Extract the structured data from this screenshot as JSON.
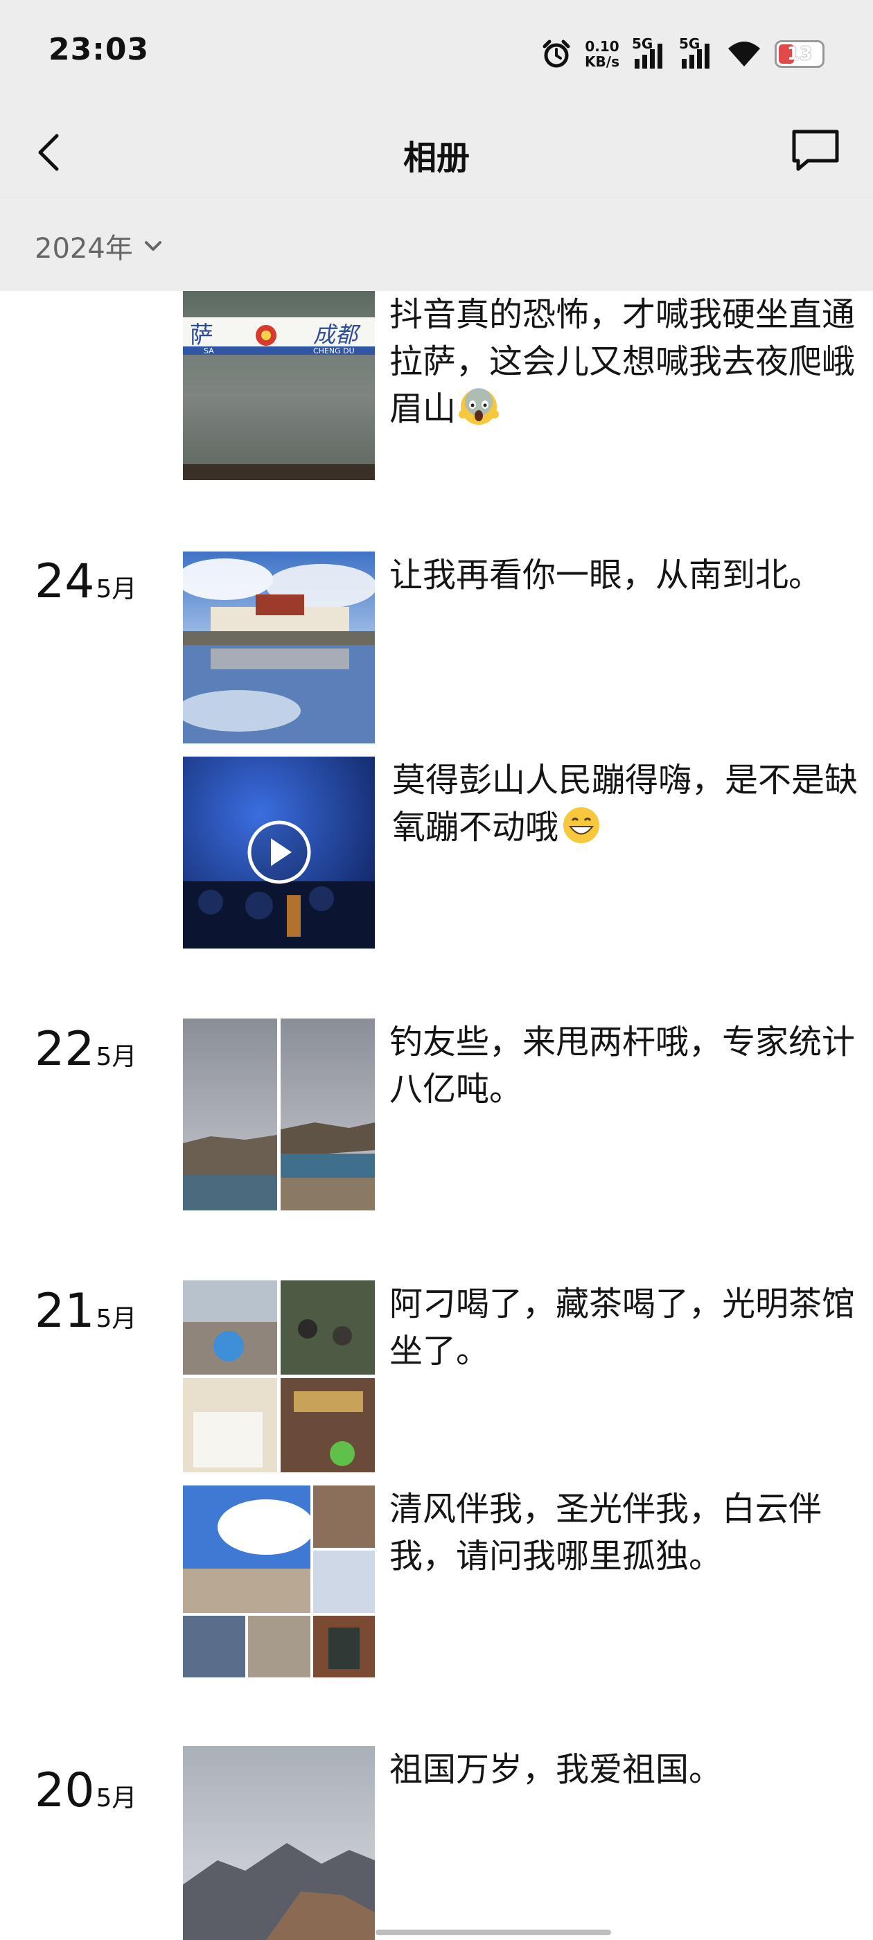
{
  "status": {
    "time": "23:03",
    "net_speed_value": "0.10",
    "net_speed_unit": "KB/s",
    "sig1": "5G",
    "sig2": "5G",
    "battery": "13"
  },
  "nav": {
    "title": "相册",
    "back_icon": "chevron-left-icon",
    "message_icon": "chat-bubble-icon"
  },
  "filter": {
    "year": "2024年",
    "dropdown_icon": "chevron-down-icon"
  },
  "entries": [
    {
      "day": "",
      "month": "",
      "caption": "抖音真的恐怖，才喊我硬坐直通拉萨，这会儿又想喊我去夜爬峨眉山",
      "emoji": "scared-face-emoji",
      "sign_text": "萨",
      "sign_text2": "成都",
      "sign_sub": "SA",
      "sign_sub2": "CHENG DU"
    },
    {
      "day": "24",
      "month": "5月",
      "caption": "让我再看你一眼，从南到北。"
    },
    {
      "day": "",
      "month": "",
      "caption": "莫得彭山人民蹦得嗨，是不是缺氧蹦不动哦",
      "emoji": "grinning-face-emoji",
      "video": true
    },
    {
      "day": "22",
      "month": "5月",
      "caption": "钓友些，来甩两杆哦，专家统计八亿吨。"
    },
    {
      "day": "21",
      "month": "5月",
      "caption": "阿刁喝了，藏茶喝了，光明茶馆坐了。"
    },
    {
      "day": "",
      "month": "",
      "caption": "清风伴我，圣光伴我，白云伴我，请问我哪里孤独。"
    },
    {
      "day": "20",
      "month": "5月",
      "caption": "祖国万岁，我爱祖国。"
    }
  ]
}
